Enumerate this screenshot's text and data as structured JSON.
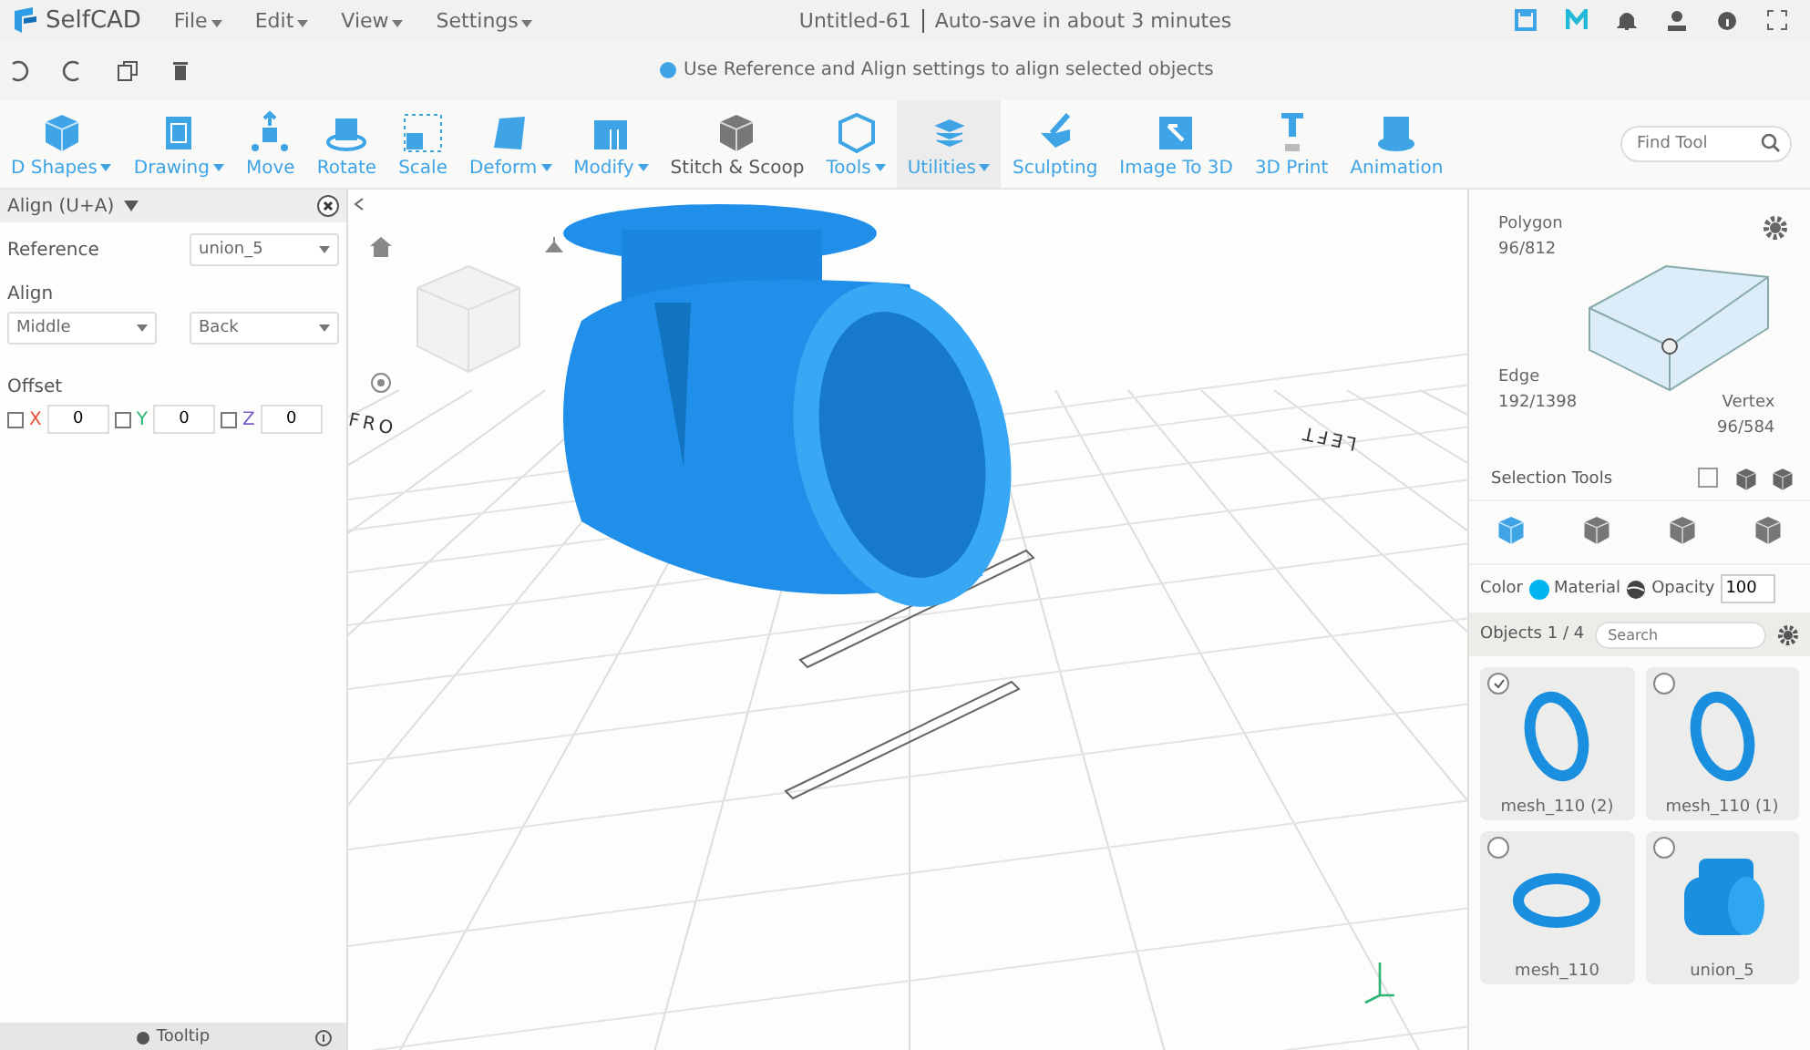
{
  "menu_bar": {
    "logo": "SelfCAD",
    "menus": [
      {
        "label": "File",
        "dropdown": true
      },
      {
        "label": "Edit",
        "dropdown": true
      },
      {
        "label": "View",
        "dropdown": true
      },
      {
        "label": "Settings",
        "dropdown": true
      }
    ],
    "document": "Untitled-61",
    "autosave": "Auto-save in about 3 minutes"
  },
  "hint": "Use Reference and Align settings to align selected objects",
  "toolbar": [
    {
      "label": "D Shapes",
      "dropdown": true,
      "selected": false
    },
    {
      "label": "Drawing",
      "dropdown": true,
      "selected": false
    },
    {
      "label": "Move",
      "dropdown": false,
      "selected": false
    },
    {
      "label": "Rotate",
      "dropdown": false,
      "selected": false
    },
    {
      "label": "Scale",
      "dropdown": false,
      "selected": false
    },
    {
      "label": "Deform",
      "dropdown": true,
      "selected": false
    },
    {
      "label": "Modify",
      "dropdown": true,
      "selected": false
    },
    {
      "label": "Stitch & Scoop",
      "dropdown": false,
      "selected": false
    },
    {
      "label": "Tools",
      "dropdown": true,
      "selected": false
    },
    {
      "label": "Utilities",
      "dropdown": true,
      "selected": true
    },
    {
      "label": "Sculpting",
      "dropdown": false,
      "selected": false
    },
    {
      "label": "Image To 3D",
      "dropdown": false,
      "selected": false
    },
    {
      "label": "3D Print",
      "dropdown": false,
      "selected": false
    },
    {
      "label": "Animation",
      "dropdown": false,
      "selected": false
    }
  ],
  "find_tool": {
    "placeholder": "Find Tool"
  },
  "align_panel": {
    "title": "Align (U+A)",
    "reference_label": "Reference",
    "reference": "union_5",
    "align_label": "Align",
    "align": [
      "Middle",
      "Back"
    ],
    "offset_label": "Offset",
    "axes": [
      {
        "label": "X",
        "color": "#e8503a",
        "checked": false,
        "value": "0"
      },
      {
        "label": "Y",
        "color": "#22b573",
        "checked": false,
        "value": "0"
      },
      {
        "label": "Z",
        "color": "#7a5cc8",
        "checked": false,
        "value": "0"
      }
    ],
    "footer": "Tooltip"
  },
  "viewport": {
    "axis_labels": [
      "FRO",
      "LEFT"
    ]
  },
  "selection_panel": {
    "polygon": {
      "label": "Polygon",
      "count": "96/812"
    },
    "edge": {
      "label": "Edge",
      "count": "192/1398"
    },
    "vertex": {
      "label": "Vertex",
      "count": "96/584"
    },
    "tools_label": "Selection Tools",
    "modes": [
      {
        "selected": true
      },
      {
        "selected": false
      },
      {
        "selected": false
      },
      {
        "selected": false
      }
    ],
    "color_label": "Color",
    "color": "#00b4f0",
    "material_label": "Material",
    "opacity_label": "Opacity",
    "opacity": "100"
  },
  "objects": {
    "title": "Objects 1 / 4",
    "search_placeholder": "Search",
    "items": [
      {
        "name": "mesh_110 (2)",
        "kind": "ring",
        "selected": true
      },
      {
        "name": "mesh_110 (1)",
        "kind": "ring",
        "selected": false
      },
      {
        "name": "mesh_110",
        "kind": "flat-ring",
        "selected": false
      },
      {
        "name": "union_5",
        "kind": "tee",
        "selected": false
      }
    ]
  }
}
